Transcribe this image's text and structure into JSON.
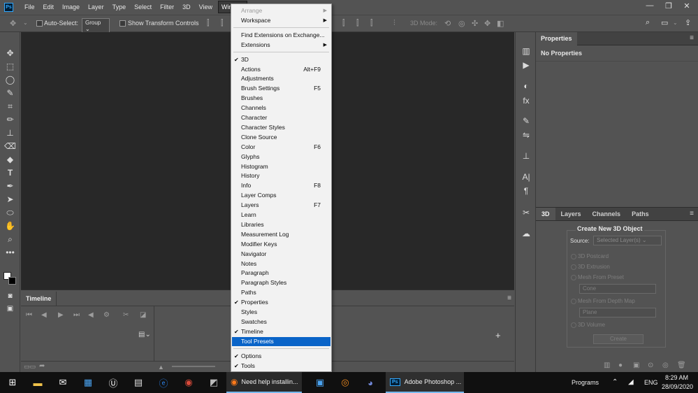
{
  "app": {
    "logo": "Ps"
  },
  "menubar": {
    "items": [
      "File",
      "Edit",
      "Image",
      "Layer",
      "Type",
      "Select",
      "Filter",
      "3D",
      "View",
      "Window"
    ],
    "active": "Window"
  },
  "window_controls": {
    "minimize": "—",
    "maximize": "❐",
    "close": "✕"
  },
  "options_bar": {
    "auto_select_label": "Auto-Select:",
    "group_value": "Group",
    "show_transform_label": "Show Transform Controls",
    "mode_label": "3D Mode:"
  },
  "window_menu": {
    "items": [
      {
        "label": "Arrange",
        "disabled": true,
        "submenu": true
      },
      {
        "label": "Workspace",
        "submenu": true
      },
      {
        "sep": true
      },
      {
        "label": "Find Extensions on Exchange..."
      },
      {
        "label": "Extensions",
        "submenu": true
      },
      {
        "sep": true
      },
      {
        "label": "3D",
        "checked": true
      },
      {
        "label": "Actions",
        "shortcut": "Alt+F9"
      },
      {
        "label": "Adjustments"
      },
      {
        "label": "Brush Settings",
        "shortcut": "F5"
      },
      {
        "label": "Brushes"
      },
      {
        "label": "Channels"
      },
      {
        "label": "Character"
      },
      {
        "label": "Character Styles"
      },
      {
        "label": "Clone Source"
      },
      {
        "label": "Color",
        "shortcut": "F6"
      },
      {
        "label": "Glyphs"
      },
      {
        "label": "Histogram"
      },
      {
        "label": "History"
      },
      {
        "label": "Info",
        "shortcut": "F8"
      },
      {
        "label": "Layer Comps"
      },
      {
        "label": "Layers",
        "shortcut": "F7"
      },
      {
        "label": "Learn"
      },
      {
        "label": "Libraries"
      },
      {
        "label": "Measurement Log"
      },
      {
        "label": "Modifier Keys"
      },
      {
        "label": "Navigator"
      },
      {
        "label": "Notes"
      },
      {
        "label": "Paragraph"
      },
      {
        "label": "Paragraph Styles"
      },
      {
        "label": "Paths"
      },
      {
        "label": "Properties",
        "checked": true
      },
      {
        "label": "Styles"
      },
      {
        "label": "Swatches"
      },
      {
        "label": "Timeline",
        "checked": true
      },
      {
        "label": "Tool Presets",
        "highlighted": true
      },
      {
        "sep": true
      },
      {
        "label": "Options",
        "checked": true
      },
      {
        "label": "Tools",
        "checked": true
      }
    ]
  },
  "timeline": {
    "tab": "Timeline"
  },
  "properties": {
    "tab": "Properties",
    "message": "No Properties"
  },
  "panel_3d": {
    "tabs": [
      "3D",
      "Layers",
      "Channels",
      "Paths"
    ],
    "active_tab": "3D",
    "title": "Create New 3D Object",
    "source_label": "Source:",
    "source_value": "Selected Layer(s)",
    "options": [
      "3D Postcard",
      "3D Extrusion",
      "Mesh From Preset"
    ],
    "preset_value": "Cone",
    "depth_label": "Mesh From Depth Map",
    "depth_value": "Plane",
    "volume_label": "3D Volume",
    "create_label": "Create"
  },
  "taskbar": {
    "tasks": [
      {
        "label": "Need help installin..."
      },
      {
        "label": "Adobe Photoshop ..."
      }
    ],
    "tray": {
      "programs": "Programs",
      "lang": "ENG",
      "time": "8:29 AM",
      "date": "28/09/2020"
    }
  },
  "colors": {
    "accent": "#0a64c8",
    "ps_blue": "#31a8ff",
    "canvas": "#282828",
    "panel": "#535353"
  }
}
